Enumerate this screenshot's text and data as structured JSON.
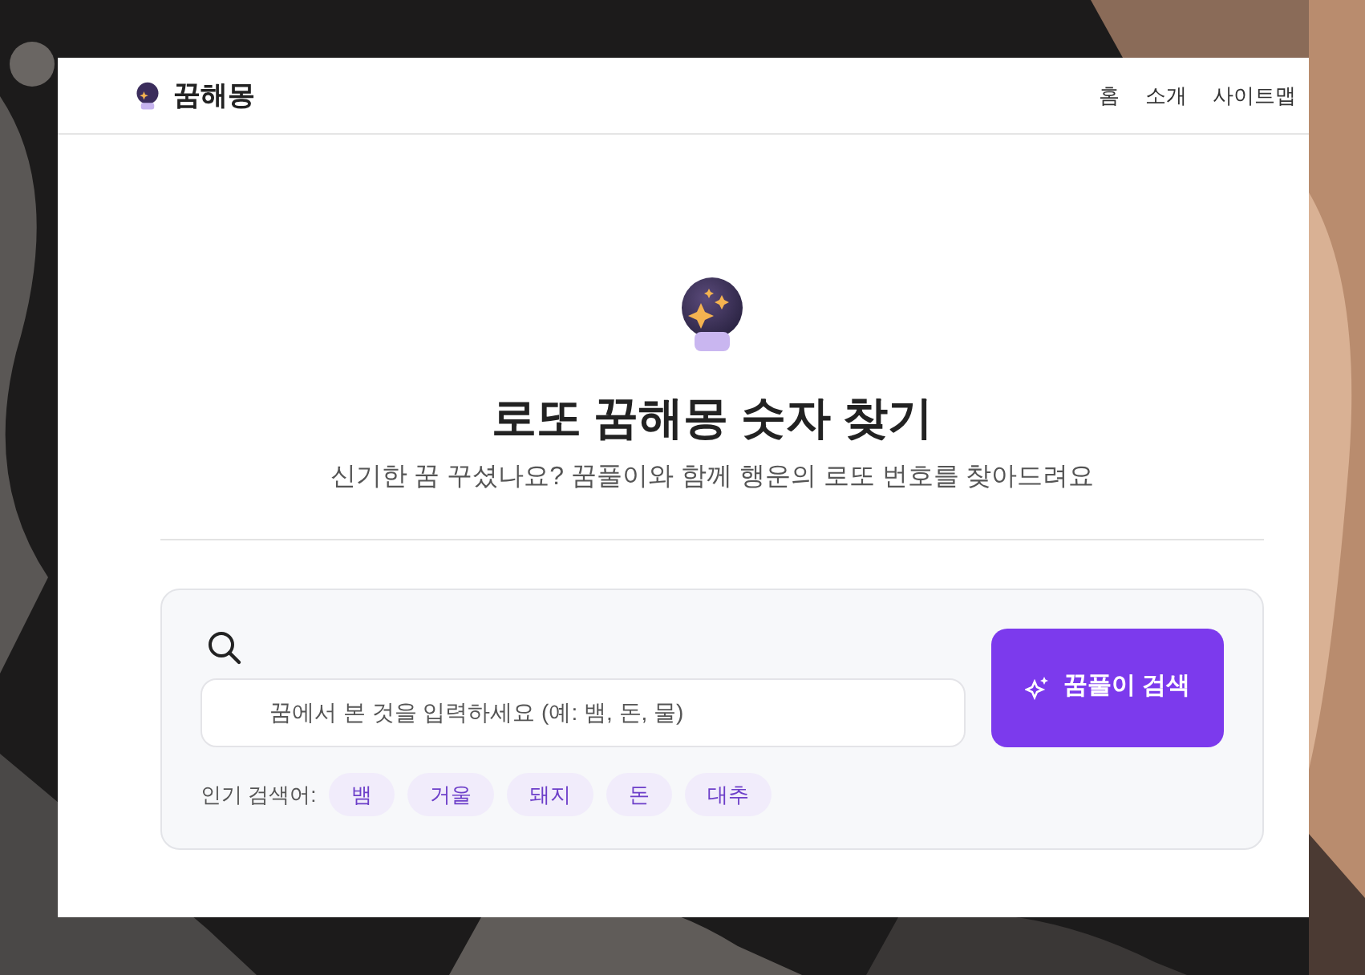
{
  "brand": {
    "name": "꿈해몽"
  },
  "nav": [
    {
      "label": "홈"
    },
    {
      "label": "소개"
    },
    {
      "label": "사이트맵"
    }
  ],
  "hero": {
    "title": "로또 꿈해몽 숫자 찾기",
    "subtitle": "신기한 꿈 꾸셨나요? 꿈풀이와 함께 행운의 로또 번호를 찾아드려요"
  },
  "search": {
    "placeholder": "꿈에서 본 것을 입력하세요 (예: 뱀, 돈, 물)",
    "button": "꿈풀이 검색",
    "popular_label": "인기 검색어:",
    "tags": [
      "뱀",
      "거울",
      "돼지",
      "돈",
      "대추"
    ]
  }
}
